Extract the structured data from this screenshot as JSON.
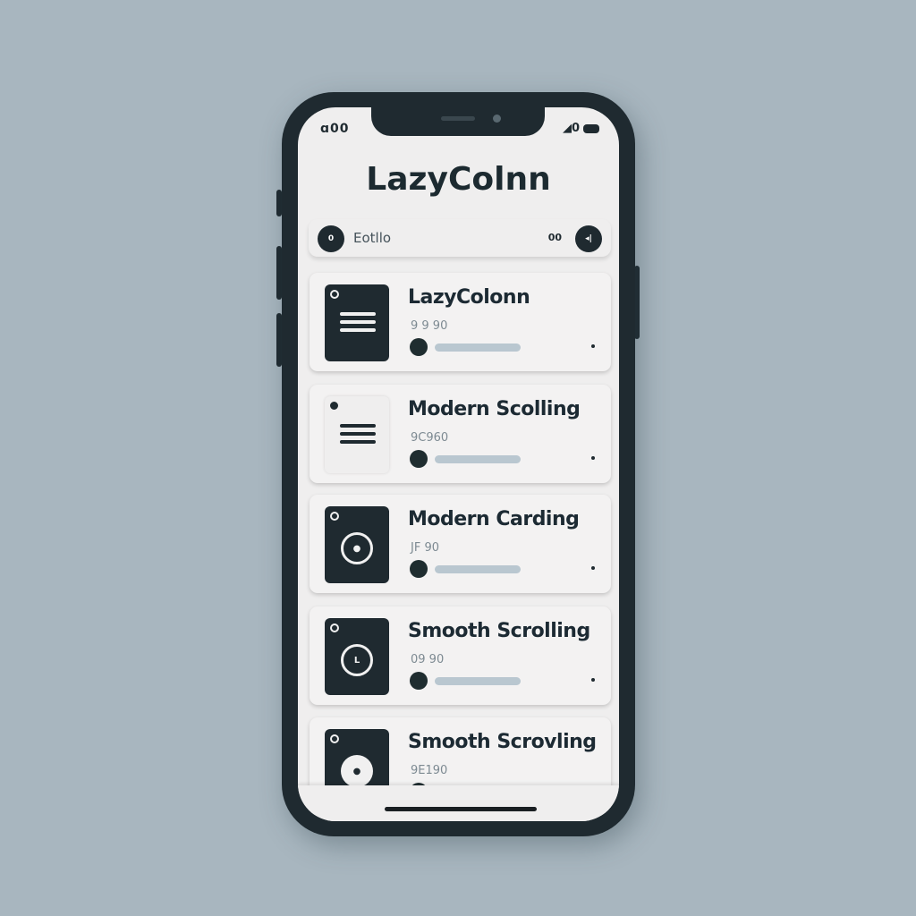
{
  "status_bar": {
    "left": "ɑ00",
    "right": "◢0"
  },
  "header": {
    "title": "LazyColnn"
  },
  "search": {
    "text": "Eotllo",
    "extra": "00",
    "left_button_glyph": "0",
    "right_button_glyph": "◂|"
  },
  "cards": [
    {
      "title": "LazyColonn",
      "subtitle": "9 9 90",
      "icon": "menu-icon",
      "icon_style": "dark"
    },
    {
      "title": "Modern Scolling",
      "subtitle": "9C960",
      "icon": "menu-icon",
      "icon_style": "light"
    },
    {
      "title": "Modern Carding",
      "subtitle": "JF 90",
      "icon": "record-icon",
      "icon_style": "dark"
    },
    {
      "title": "Smooth Scrolling",
      "subtitle": "09 90",
      "icon": "clock-icon",
      "icon_style": "dark"
    },
    {
      "title": "Smooth Scrovling",
      "subtitle": "9E190",
      "icon": "record-icon",
      "icon_style": "dark"
    }
  ],
  "colors": {
    "background": "#a8b6bf",
    "phone": "#1f2a30",
    "screen": "#efeeee",
    "track": "#b9c7d0"
  }
}
